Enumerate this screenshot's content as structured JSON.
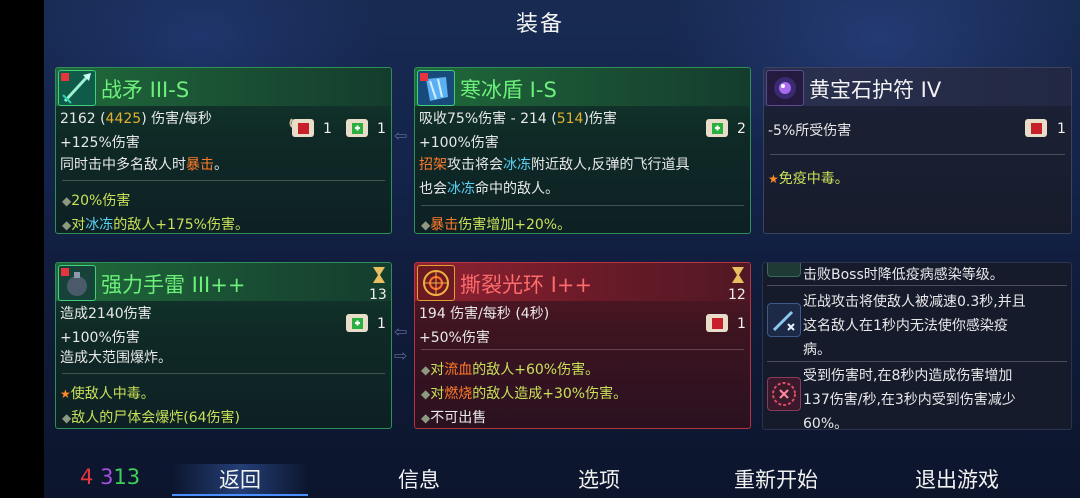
{
  "screen_title": "装备",
  "cards": {
    "spear": {
      "name": "战矛 III-S",
      "dps_base": "2162 (",
      "dps_value": "4425",
      "dps_tail": ") 伤害/每秒",
      "dmg": "+125%伤害",
      "desc_a": "同时击中多名敌人时",
      "desc_b": "暴击",
      "desc_c": "。",
      "scroll1_count": "1",
      "scroll2_count": "1",
      "mod1": "20%伤害",
      "mod2_a": "对",
      "mod2_b": "冰冻",
      "mod2_c": "的敌人+175%伤害。"
    },
    "shield": {
      "name": "寒冰盾 I-S",
      "line1_a": "吸收75%伤害 - 214 (",
      "line1_b": "514",
      "line1_c": ")伤害",
      "dmg": "+100%伤害",
      "scroll_count": "2",
      "desc1_a": "招架",
      "desc1_b": "攻击将会",
      "desc1_c": "冰冻",
      "desc1_d": "附近敌人,反弹的飞行道具",
      "desc2_a": "也会",
      "desc2_b": "冰冻",
      "desc2_c": "命中的敌人。",
      "mod1_a": "暴击",
      "mod1_b": "伤害增加+20%。"
    },
    "amulet": {
      "name": "黄宝石护符 IV",
      "line1": "-5%所受伤害",
      "scroll_count": "1",
      "mod1_a": "免疫",
      "mod1_b": "中毒",
      "mod1_c": "。"
    },
    "grenade": {
      "name": "强力手雷 III++",
      "cooldown": "13",
      "line1": "造成2140伤害",
      "dmg": "+100%伤害",
      "scroll_count": "1",
      "desc": "造成大范围爆炸。",
      "mod1_a": "使敌人",
      "mod1_b": "中毒",
      "mod1_c": "。",
      "mod2": "敌人的尸体会爆炸(64伤害)"
    },
    "aura": {
      "name": "撕裂光环 I++",
      "cooldown": "12",
      "line1": "194 伤害/每秒 (4秒)",
      "dmg": "+50%伤害",
      "scroll_count": "1",
      "mod1_a": "对",
      "mod1_b": "流血",
      "mod1_c": "的敌人+60%伤害。",
      "mod2_a": "对",
      "mod2_b": "燃烧",
      "mod2_c": "的敌人造成+30%伤害。",
      "mod3": "不可出售"
    }
  },
  "mutations": {
    "item1": "击败Boss时降低疫病感染等级。",
    "item2_l1": "近战攻击将使敌人被减速0.3秒,并且",
    "item2_l2": "这名敌人在1秒内无法使你感染疫",
    "item2_l3": "病。",
    "item3_l1": "受到伤害时,在8秒内造成伤害增加",
    "item3_l2": "137伤害/秒,在3秒内受到伤害减少",
    "item3_l3": "60%。"
  },
  "bottom": {
    "count_red": "4",
    "count_purple": "3",
    "count_green": "13",
    "nav": [
      "返回",
      "信息",
      "选项",
      "重新开始",
      "退出游戏"
    ]
  },
  "colors": {
    "brutality": "#e8343c",
    "tactics": "#a44fe0",
    "survival": "#3ed05a",
    "accent_blue": "#4a90ff"
  }
}
